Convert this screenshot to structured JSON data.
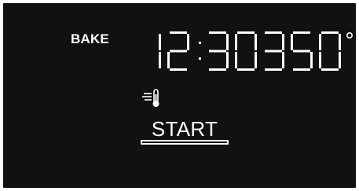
{
  "display": {
    "mode": "BAKE",
    "time": "12:30",
    "temperature": "350",
    "temperature_unit": "°",
    "status_icon": "convection-fan-thermometer-icon",
    "start_label": "START"
  },
  "colors": {
    "background": "#111111",
    "foreground": "#ffffff"
  }
}
